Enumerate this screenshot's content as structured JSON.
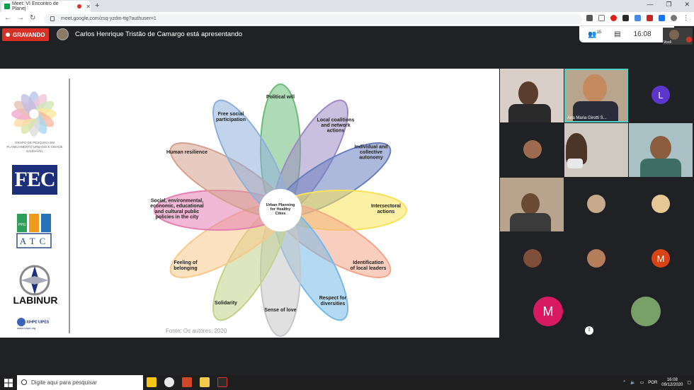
{
  "browser": {
    "tab_title": "Meet: VI Encontro de Planej",
    "new_tab": "+",
    "url": "meet.google.com/zsq-yzdm-ttg?authuser=1",
    "win_min": "—",
    "win_max": "❐",
    "win_close": "✕"
  },
  "meet": {
    "recording_label": "GRAVANDO",
    "presenting_text": "Carlos Henrique Tristão de Camargo está apresentando",
    "participant_count": "15",
    "time": "16:08",
    "self_label": "Você"
  },
  "slide": {
    "left_logos": {
      "caption": "GRUPO DE PESQUISA EM PLANEJAMENTO URBANO E CIDADE SAUDÁVEL",
      "fec": "FEC",
      "ppg": "PPG",
      "atc": "ATC",
      "labinur": "LABINUR",
      "iuhpe": "IUHPE UIPES",
      "iuhpe_sub": "www.iuhpe.org"
    },
    "center": "Urban Planning for Healthy Cities",
    "petals": [
      {
        "label": "Political will",
        "color": "#6dbb7a"
      },
      {
        "label": "Local coalitions and network actions",
        "color": "#9d8ac2"
      },
      {
        "label": "Individual and collective autonomy",
        "color": "#6a7fc0"
      },
      {
        "label": "Intersectoral actions",
        "color": "#f7e35a"
      },
      {
        "label": "Identification of local leaders",
        "color": "#f4a58a"
      },
      {
        "label": "Respect for diversities",
        "color": "#76b9e8"
      },
      {
        "label": "Sense of love",
        "color": "#c7c7c7"
      },
      {
        "label": "Solidarity",
        "color": "#c3d28a"
      },
      {
        "label": "Feeling of belonging",
        "color": "#f8c98a"
      },
      {
        "label": "Social, environmental, economic, educational and cultural public policies in the city",
        "color": "#e57fb3"
      },
      {
        "label": "Human resilience",
        "color": "#d5a08c"
      },
      {
        "label": "Free social participation",
        "color": "#8fb0da"
      }
    ],
    "source": "Fonte: Os autores, 2020"
  },
  "participants": {
    "highlight_name": "Ana Maria Girotti S...",
    "initial_L": "L",
    "initial_M1": "M",
    "initial_M2": "M",
    "color_L": "#5c35cc",
    "color_M1": "#d84315",
    "color_M2": "#d81b60"
  },
  "taskbar": {
    "search_placeholder": "Digite aqui para pesquisar",
    "lang": "POR",
    "time": "16:08",
    "date": "09/12/2020"
  }
}
